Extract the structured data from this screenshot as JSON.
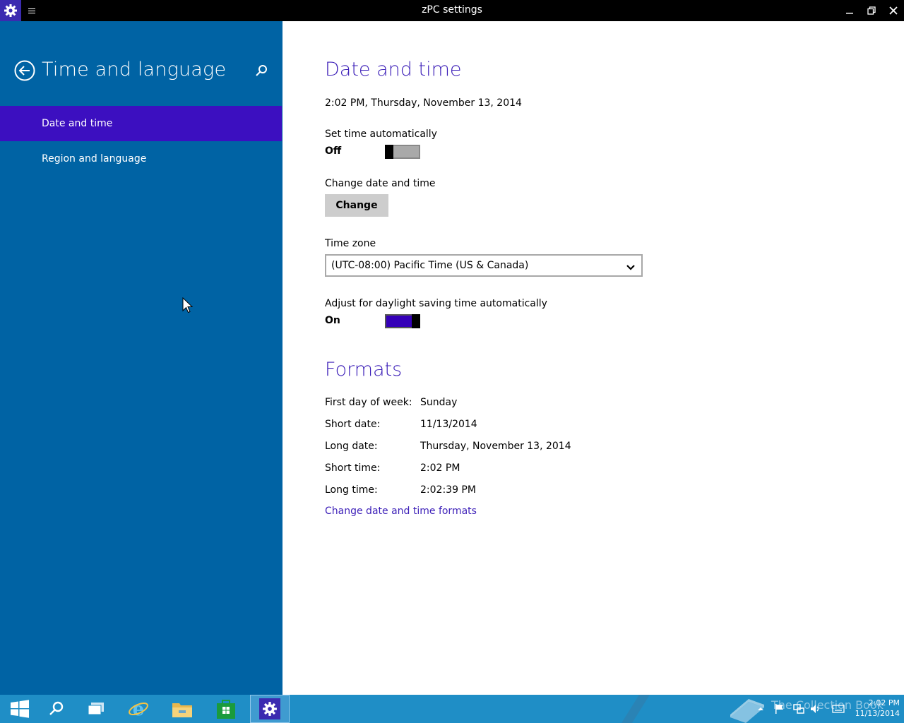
{
  "window": {
    "title": "zPC settings"
  },
  "sidebar": {
    "title": "Time and language",
    "items": [
      {
        "label": "Date and time",
        "active": true
      },
      {
        "label": "Region and language",
        "active": false
      }
    ]
  },
  "main": {
    "date_time_heading": "Date and time",
    "current_datetime": "2:02 PM, Thursday, November 13, 2014",
    "set_time_auto": {
      "label": "Set time automatically",
      "state": "Off"
    },
    "change_date_time": {
      "label": "Change date and time",
      "button": "Change"
    },
    "time_zone": {
      "label": "Time zone",
      "value": "(UTC-08:00) Pacific Time (US & Canada)"
    },
    "dst": {
      "label": "Adjust for daylight saving time automatically",
      "state": "On"
    },
    "formats_heading": "Formats",
    "formats": [
      {
        "label": "First day of week:",
        "value": "Sunday"
      },
      {
        "label": "Short date:",
        "value": "11/13/2014"
      },
      {
        "label": "Long date:",
        "value": "Thursday, November 13, 2014"
      },
      {
        "label": "Short time:",
        "value": "2:02 PM"
      },
      {
        "label": "Long time:",
        "value": "2:02:39 PM"
      }
    ],
    "formats_link": "Change date and time formats"
  },
  "taskbar": {
    "clock_time": "2:02 PM",
    "clock_date": "11/13/2014",
    "watermark": "The Collection Book"
  },
  "colors": {
    "sidebar_bg": "#0063a4",
    "nav_active": "#3c0fc0",
    "accent_text": "#3c1fb8",
    "toggle_on": "#3500b8",
    "taskbar": "#1f8ec6"
  }
}
